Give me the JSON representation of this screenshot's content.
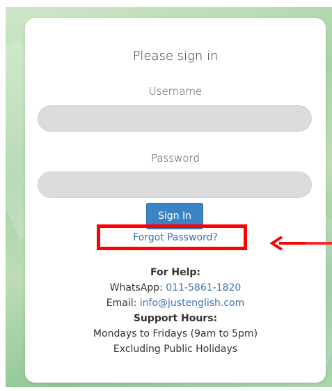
{
  "login": {
    "title": "Please sign in",
    "username_label": "Username",
    "username_value": "",
    "password_label": "Password",
    "password_value": "",
    "sign_in_label": "Sign In",
    "forgot_label": "Forgot Password?"
  },
  "help": {
    "heading": "For Help:",
    "whatsapp_label": "WhatsApp:",
    "whatsapp_number": "011-5861-1820",
    "email_label": "Email:",
    "email_address": "info@justenglish.com",
    "hours_heading": "Support Hours:",
    "hours_text": "Mondays to Fridays (9am to 5pm)",
    "hours_note": "Excluding Public Holidays"
  },
  "annotation": {
    "color": "#ff0000",
    "icon": "arrow-left-icon"
  },
  "colors": {
    "button": "#3b84c4",
    "link": "#3b6fb0",
    "input_bg": "#dcdcdc"
  }
}
